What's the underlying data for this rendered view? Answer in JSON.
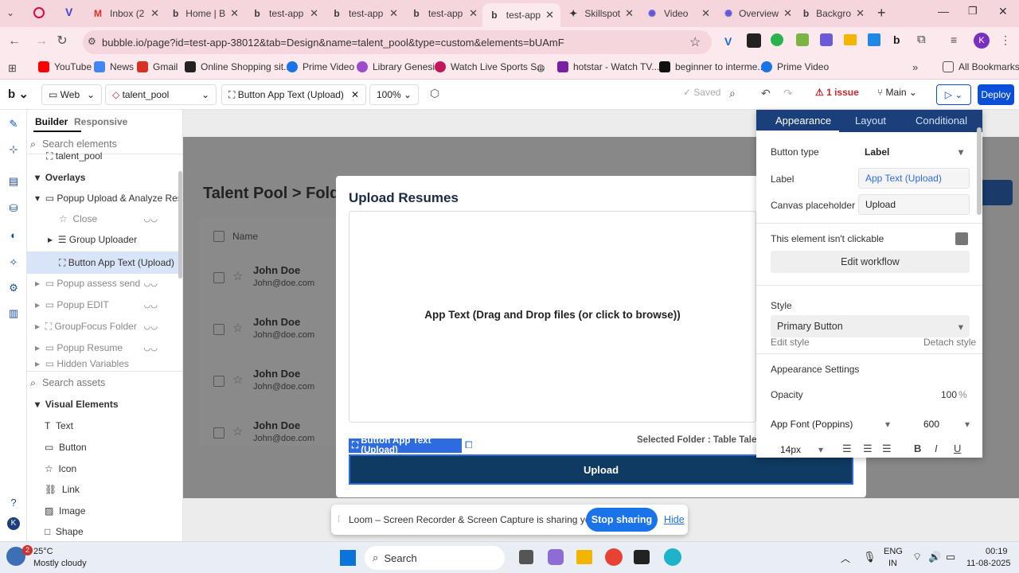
{
  "browser": {
    "tabs": [
      {
        "label": "Inbox (2",
        "icon": "gmail-icon"
      },
      {
        "label": "Home | B",
        "icon": "bubble-icon"
      },
      {
        "label": "test-app",
        "icon": "bubble-icon"
      },
      {
        "label": "test-app",
        "icon": "bubble-icon"
      },
      {
        "label": "test-app",
        "icon": "bubble-icon"
      },
      {
        "label": "test-app",
        "icon": "bubble-icon"
      },
      {
        "label": "Skillspot",
        "icon": "skillspot-icon"
      },
      {
        "label": "Video",
        "icon": "gear-icon"
      },
      {
        "label": "Overview",
        "icon": "gear-icon"
      },
      {
        "label": "Backgro",
        "icon": "bubble-icon"
      }
    ],
    "url": "bubble.io/page?id=test-app-38012&tab=Design&name=talent_pool&type=custom&elements=bUAmF",
    "bookmarks": [
      "YouTube",
      "News",
      "Gmail",
      "Online Shopping sit...",
      "Prime Video",
      "Library Genesis",
      "Watch Live Sports S...",
      "hotstar - Watch TV...",
      "beginner to interme...",
      "Prime Video"
    ],
    "all_bookmarks": "All Bookmarks"
  },
  "toolbar": {
    "platform": "Web",
    "page": "talent_pool",
    "element": "Button App Text (Upload)",
    "zoom": "100%",
    "saved": "Saved",
    "issues": "1 issue",
    "branch": "Main",
    "deploy": "Deploy"
  },
  "leftpanel": {
    "tabs": [
      "Builder",
      "Responsive"
    ],
    "search_elements": "Search elements",
    "tree": [
      {
        "label": "talent_pool"
      },
      {
        "label": "Overlays"
      },
      {
        "label": "Popup Upload & Analyze Res..."
      },
      {
        "label": "Close"
      },
      {
        "label": "Group Uploader"
      },
      {
        "label": "Button App Text (Upload)"
      },
      {
        "label": "Popup assess send"
      },
      {
        "label": "Popup EDIT"
      },
      {
        "label": "GroupFocus Folder"
      },
      {
        "label": "Popup Resume"
      },
      {
        "label": "Hidden Variables"
      }
    ],
    "search_assets": "Search assets",
    "visual_header": "Visual Elements",
    "visual": [
      "Text",
      "Button",
      "Icon",
      "Link",
      "Image",
      "Shape"
    ]
  },
  "canvas": {
    "breadcrumb_1": "Talent Pool",
    "breadcrumb_sep": ">",
    "breadcrumb_2": "Fold",
    "name_header": "Name",
    "rows": [
      {
        "name": "John Doe",
        "email": "John@doe.com"
      },
      {
        "name": "John Doe",
        "email": "John@doe.com"
      },
      {
        "name": "John Doe",
        "email": "John@doe.com"
      },
      {
        "name": "John Doe",
        "email": "John@doe.com"
      }
    ],
    "popup_title": "Upload Resumes",
    "dropzone_text": "App Text (Drag and Drop files (or click to browse))",
    "selected_folder": "Selected Folder : Table TalentF",
    "selected_tag": "Button App Text (Upload)",
    "upload_label": "Upload"
  },
  "editor": {
    "tabs": [
      "Appearance",
      "Layout",
      "Conditional"
    ],
    "button_type_label": "Button type",
    "button_type": "Label",
    "label_label": "Label",
    "label_value": "App Text (Upload)",
    "placeholder_label": "Canvas placeholder",
    "placeholder_value": "Upload",
    "not_clickable": "This element isn't clickable",
    "edit_workflow": "Edit workflow",
    "style_label": "Style",
    "style_value": "Primary Button",
    "edit_style": "Edit style",
    "detach_style": "Detach style",
    "appearance_settings": "Appearance Settings",
    "opacity_label": "Opacity",
    "opacity_value": "100",
    "opacity_unit": "%",
    "font": "App Font (Poppins)",
    "weight": "600",
    "font_size": "14px"
  },
  "loom": {
    "message": "Loom – Screen Recorder & Screen Capture is sharing your screen.",
    "stop": "Stop sharing",
    "hide": "Hide"
  },
  "taskbar": {
    "temp": "25°C",
    "weather": "Mostly cloudy",
    "badge": "2",
    "search": "Search",
    "lang1": "ENG",
    "lang2": "IN",
    "time": "00:19",
    "date": "11-08-2025"
  },
  "colors": {
    "accent": "#0b4fd6",
    "upload_bg": "#0f3a61",
    "editor_head": "#1a3f7a",
    "selection": "#2d6be0"
  }
}
